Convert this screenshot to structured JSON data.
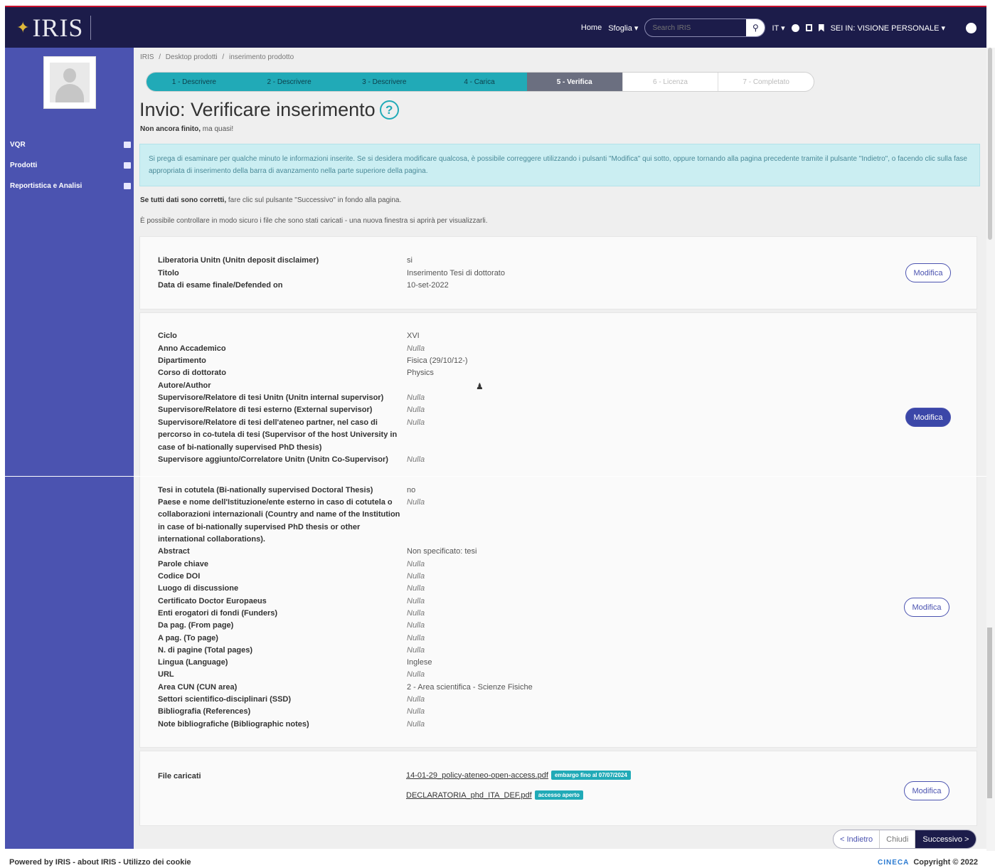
{
  "header": {
    "logo": "IRIS",
    "nav": {
      "home": "Home",
      "browse": "Sfoglia ▾",
      "search_placeholder": "Search IRIS",
      "lang": "IT ▾",
      "view_mode": "SEI IN: VISIONE PERSONALE ▾"
    }
  },
  "sidebar": {
    "items": [
      {
        "label": "VQR",
        "icon": "list-icon"
      },
      {
        "label": "Prodotti",
        "icon": "document-icon"
      },
      {
        "label": "Reportistica e Analisi",
        "icon": "calendar-icon"
      }
    ]
  },
  "breadcrumb": [
    "IRIS",
    "/",
    "Desktop prodotti",
    "/",
    "inserimento prodotto"
  ],
  "steps": [
    {
      "label": "1 - Descrivere",
      "state": "done"
    },
    {
      "label": "2 - Descrivere",
      "state": "done"
    },
    {
      "label": "3 - Descrivere",
      "state": "done"
    },
    {
      "label": "4 - Carica",
      "state": "done"
    },
    {
      "label": "5 - Verifica",
      "state": "active"
    },
    {
      "label": "6 - Licenza",
      "state": "todo"
    },
    {
      "label": "7 - Completato",
      "state": "todo"
    }
  ],
  "page": {
    "title": "Invio: Verificare inserimento",
    "subtitle_bold": "Non ancora finito,",
    "subtitle_rest": " ma quasi!",
    "alert": "Si prega di esaminare per qualche minuto le informazioni inserite. Se si desidera modificare qualcosa, è possibile correggere utilizzando i pulsanti \"Modifica\" qui sotto, oppure tornando alla pagina precedente tramite il pulsante \"Indietro\", o facendo clic sulla fase appropriata di inserimento della barra di avanzamento nella parte superiore della pagina.",
    "note1_bold": "Se tutti dati sono corretti,",
    "note1_rest": " fare clic sul pulsante \"Successivo\" in fondo alla pagina.",
    "note2": "È possibile controllare in modo sicuro i file che sono stati caricati - una nuova finestra si aprirà per visualizzarli."
  },
  "section1": {
    "rows": [
      {
        "k": "Liberatoria Unitn (Unitn deposit disclaimer)",
        "v": "si"
      },
      {
        "k": "Titolo",
        "v": "Inserimento Tesi di dottorato"
      },
      {
        "k": "Data di esame finale/Defended on",
        "v": "10-set-2022"
      }
    ],
    "button": "Modifica"
  },
  "section2": {
    "rows": [
      {
        "k": "Ciclo",
        "v": "XVI"
      },
      {
        "k": "Anno Accademico",
        "v": "Nulla"
      },
      {
        "k": "Dipartimento",
        "v": "Fisica (29/10/12-)"
      },
      {
        "k": "Corso di dottorato",
        "v": "Physics"
      },
      {
        "k": "Autore/Author",
        "v": ""
      },
      {
        "k": "Supervisore/Relatore di tesi Unitn (Unitn internal supervisor)",
        "v": "Nulla"
      },
      {
        "k": "Supervisore/Relatore di tesi esterno (External supervisor)",
        "v": "Nulla"
      },
      {
        "k": "Supervisore/Relatore di tesi dell'ateneo partner, nel caso di percorso in co-tutela di tesi (Supervisor of the host University in case of bi-nationally supervised PhD thesis)",
        "v": "Nulla"
      },
      {
        "k": "Supervisore aggiunto/Correlatore Unitn (Unitn Co-Supervisor)",
        "v": "Nulla"
      }
    ],
    "button": "Modifica"
  },
  "section3": {
    "rows": [
      {
        "k": "Tesi in cotutela (Bi-nationally supervised Doctoral Thesis)",
        "v": "no"
      },
      {
        "k": "Paese e nome dell'Istituzione/ente esterno in caso di cotutela o collaborazioni internazionali (Country and name of the Institution in case of bi-nationally supervised PhD thesis or other international collaborations).",
        "v": "Nulla"
      },
      {
        "k": "Abstract",
        "v": "Non specificato: tesi"
      },
      {
        "k": "Parole chiave",
        "v": "Nulla"
      },
      {
        "k": "Codice DOI",
        "v": "Nulla"
      },
      {
        "k": "Luogo di discussione",
        "v": "Nulla"
      },
      {
        "k": "Certificato Doctor Europaeus",
        "v": "Nulla"
      },
      {
        "k": "Enti erogatori di fondi (Funders)",
        "v": "Nulla"
      },
      {
        "k": "Da pag. (From page)",
        "v": "Nulla"
      },
      {
        "k": "A pag. (To page)",
        "v": "Nulla"
      },
      {
        "k": "N. di pagine (Total pages)",
        "v": "Nulla"
      },
      {
        "k": "Lingua (Language)",
        "v": "Inglese"
      },
      {
        "k": "URL",
        "v": "Nulla"
      },
      {
        "k": "Area CUN (CUN area)",
        "v": "2 - Area scientifica - Scienze Fisiche"
      },
      {
        "k": "Settori scientifico-disciplinari (SSD)",
        "v": "Nulla"
      },
      {
        "k": "Bibliografia (References)",
        "v": "Nulla"
      },
      {
        "k": "Note bibliografiche (Bibliographic notes)",
        "v": "Nulla"
      }
    ],
    "button": "Modifica"
  },
  "section4": {
    "label": "File caricati",
    "files": [
      {
        "name": "14-01-29_policy-ateneo-open-access.pdf",
        "badge": "embargo fino al 07/07/2024"
      },
      {
        "name": "DECLARATORIA_phd_ITA_DEF.pdf",
        "badge": "accesso aperto"
      }
    ],
    "button": "Modifica"
  },
  "actions": {
    "back": "< Indietro",
    "close": "Chiudi",
    "next": "Successivo >"
  },
  "footer": {
    "powered": "Powered by IRIS",
    "sep1": " - ",
    "about": "about IRIS",
    "sep2": " - ",
    "cookies": "Utilizzo dei cookie",
    "cineca": "CINECA",
    "copyright": "Copyright © 2022"
  }
}
